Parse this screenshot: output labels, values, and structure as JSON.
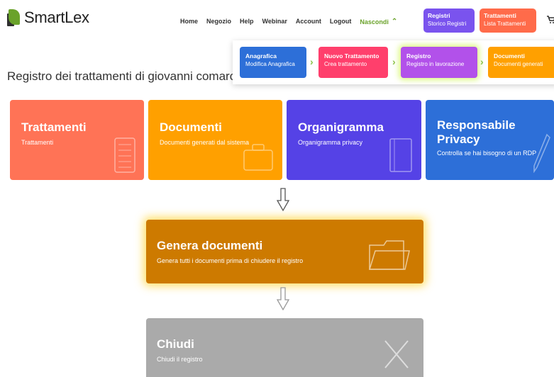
{
  "brand": {
    "name": "SmartLex"
  },
  "nav": {
    "items": [
      "Home",
      "Negozio",
      "Help",
      "Webinar",
      "Account",
      "Logout"
    ],
    "nascondi": "Nascondi"
  },
  "quick_buttons": {
    "registri": {
      "title": "Registri",
      "subtitle": "Storico Registri"
    },
    "trattamenti": {
      "title": "Trattamenti",
      "subtitle": "Lista Trattamenti"
    }
  },
  "flow": {
    "steps": [
      {
        "title": "Anagrafica",
        "subtitle": "Modifica Anagrafica"
      },
      {
        "title": "Nuovo Trattamento",
        "subtitle": "Crea trattamento"
      },
      {
        "title": "Registro",
        "subtitle": "Registro in lavorazione"
      },
      {
        "title": "Documenti",
        "subtitle": "Documenti generati"
      }
    ]
  },
  "page": {
    "title": "Registro dei trattamenti di giovanni comarce"
  },
  "cards": [
    {
      "title": "Trattamenti",
      "desc": "Trattamenti",
      "color": "#ff7356"
    },
    {
      "title": "Documenti",
      "desc": "Documenti generati dal sistema",
      "color": "#ffa000"
    },
    {
      "title": "Organigramma",
      "desc": "Organigramma privacy",
      "color": "#5542e6"
    },
    {
      "title": "Responsabile Privacy",
      "desc": "Controlla se hai bisogno di un RDP",
      "color": "#2d6fd8"
    }
  ],
  "genera": {
    "title": "Genera documenti",
    "desc": "Genera tutti i documenti prima di chiudere il registro",
    "color": "#cd7a00"
  },
  "chiudi": {
    "title": "Chiudi",
    "desc": "Chiudi il registro",
    "color": "#aaaaaa"
  },
  "colors": {
    "accent_green": "#6aa22a"
  },
  "icons": [
    "cart-icon",
    "chevron-up-icon",
    "chevron-right-icon",
    "checklist-icon",
    "briefcase-icon",
    "notebook-icon",
    "pen-icon",
    "folder-icon",
    "x-icon",
    "down-arrow-icon"
  ]
}
